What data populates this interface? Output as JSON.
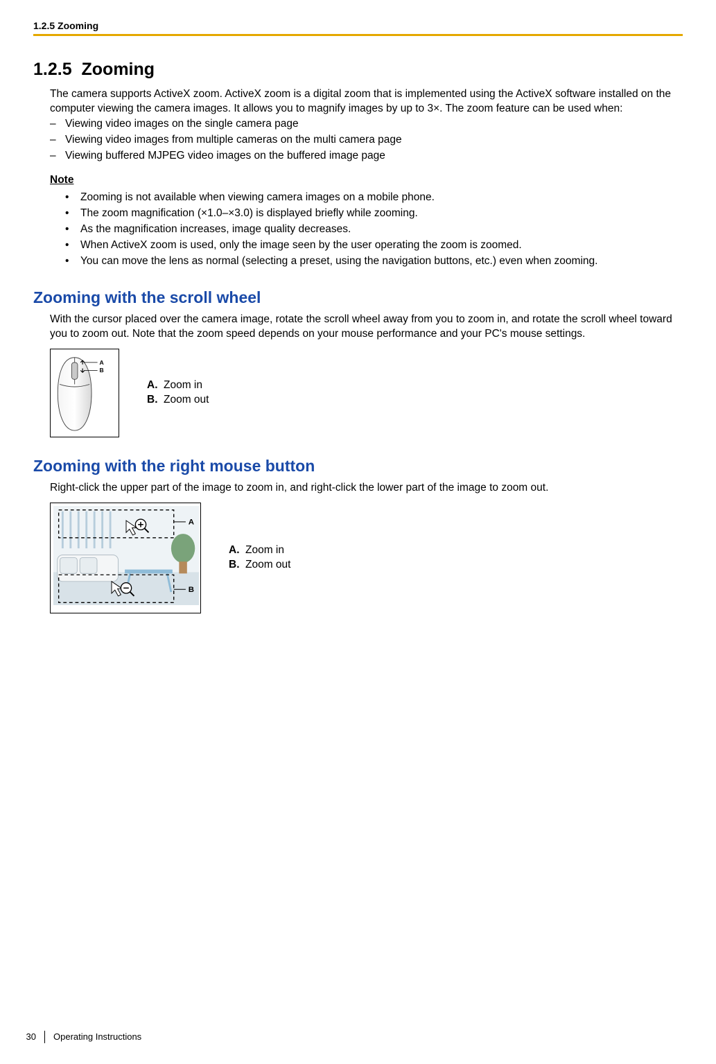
{
  "header": {
    "running": "1.2.5 Zooming"
  },
  "section": {
    "number": "1.2.5",
    "title": "Zooming",
    "intro": "The camera supports ActiveX zoom. ActiveX zoom is a digital zoom that is implemented using the ActiveX software installed on the computer viewing the camera images. It allows you to magnify images by up to 3×. The zoom feature can be used when:",
    "when": [
      "Viewing video images on the single camera page",
      "Viewing video images from multiple cameras on the multi camera page",
      "Viewing buffered MJPEG video images on the buffered image page"
    ],
    "note_label": "Note",
    "notes": [
      "Zooming is not available when viewing camera images on a mobile phone.",
      "The zoom magnification (×1.0–×3.0) is displayed briefly while zooming.",
      "As the magnification increases, image quality decreases.",
      "When ActiveX zoom is used, only the image seen by the user operating the zoom is zoomed.",
      "You can move the lens as normal (selecting a preset, using the navigation buttons, etc.) even when zooming."
    ]
  },
  "scroll": {
    "title": "Zooming with the scroll wheel",
    "desc": "With the cursor placed over the camera image, rotate the scroll wheel away from you to zoom in, and rotate the scroll wheel toward you to zoom out. Note that the zoom speed depends on your mouse performance and your PC's mouse settings.",
    "legend": {
      "a_key": "A.",
      "a_val": "Zoom in",
      "b_key": "B.",
      "b_val": "Zoom out"
    },
    "label_a": "A",
    "label_b": "B"
  },
  "right": {
    "title": "Zooming with the right mouse button",
    "desc": "Right-click the upper part of the image to zoom in, and right-click the lower part of the image to zoom out.",
    "legend": {
      "a_key": "A.",
      "a_val": "Zoom in",
      "b_key": "B.",
      "b_val": "Zoom out"
    },
    "label_a": "A",
    "label_b": "B"
  },
  "footer": {
    "page": "30",
    "doc": "Operating Instructions"
  }
}
